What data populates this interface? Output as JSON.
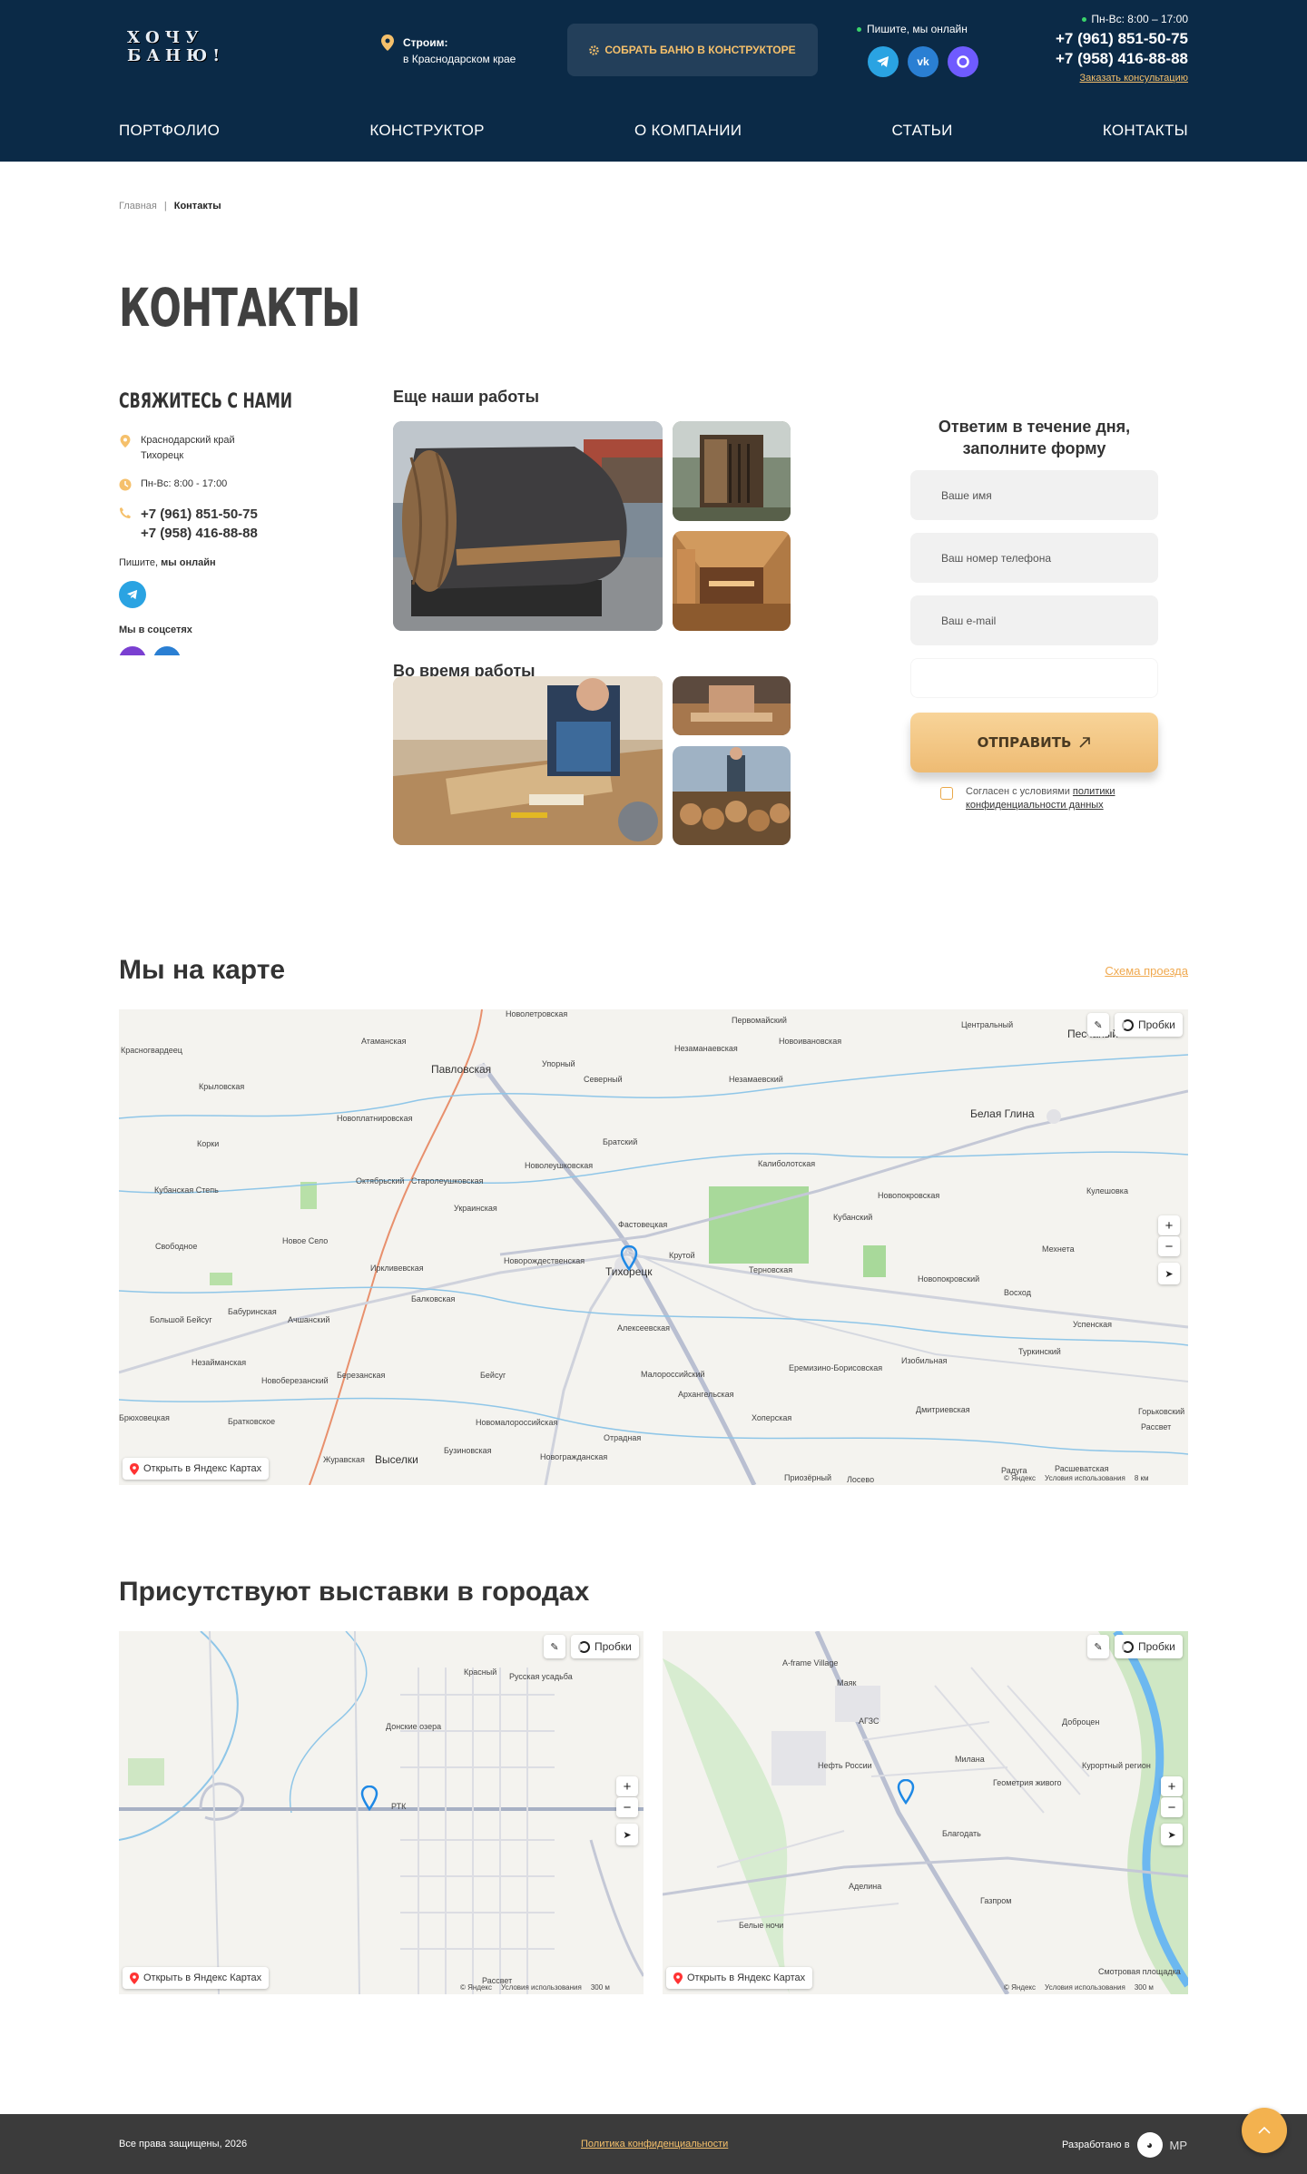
{
  "header": {
    "logo_line1": "ХОЧУ",
    "logo_line2": "БАНЮ!",
    "build_title": "Строим:",
    "build_region": "в Краснодарском крае",
    "constructor_button": "СОБРАТЬ БАНЮ В КОНСТРУКТОРЕ",
    "online_label": "Пишите, мы онлайн",
    "hours": "Пн-Вс: 8:00 – 17:00",
    "phone1": "+7 (961) 851-50-75",
    "phone2": "+7 (958) 416-88-88",
    "consult_link": "Заказать консультацию",
    "nav": [
      "ПОРТФОЛИО",
      "КОНСТРУКТОР",
      "О КОМПАНИИ",
      "СТАТЬИ",
      "КОНТАКТЫ"
    ]
  },
  "breadcrumb": {
    "home": "Главная",
    "separator": "|",
    "current": "Контакты"
  },
  "page_title": "КОНТАКТЫ",
  "contact": {
    "heading": "СВЯЖИТЕСЬ С НАМИ",
    "address_line1": "Краснодарский край",
    "address_line2": "Тихорецк",
    "hours": "Пн-Вс: 8:00 - 17:00",
    "phone1": "+7 (961) 851-50-75",
    "phone2": "+7 (958) 416-88-88",
    "write_prefix": "Пишите, ",
    "write_bold": "мы онлайн",
    "socials_label": "Мы в соцсетях"
  },
  "works": {
    "more_title": "Еще наши работы",
    "during_title": "Во время работы"
  },
  "form": {
    "title": "Ответим в течение дня, заполните форму",
    "name_placeholder": "Ваше имя",
    "phone_placeholder": "Ваш номер телефона",
    "email_placeholder": "Ваш e-mail",
    "submit": "ОТПРАВИТЬ",
    "agree_text": "Согласен с условиями ",
    "agree_link": "политики конфиденциальности данных"
  },
  "map_section": {
    "title": "Мы на карте",
    "route_link": "Схема проезда",
    "labels": [
      "Новолетровская",
      "Первомайский",
      "Центральный",
      "Песчаный",
      "Красногвардеец",
      "Атаманская",
      "Павловская",
      "Упорный",
      "Незаманаевская",
      "Новоивановская",
      "Крыловская",
      "Северный",
      "Незамаевский",
      "Новоплатнировская",
      "Братский",
      "Белая Глина",
      "Корки",
      "Новолеушковская",
      "Калиболотская",
      "Кубанская Степь",
      "Октябрьский",
      "Старолеушковская",
      "Новопокровская",
      "Кулешовка",
      "Украинская",
      "Фастовецкая",
      "Кубанский",
      "Свободное",
      "Новое Село",
      "Новорождественская",
      "Тихорецк",
      "Крутой",
      "Терновская",
      "Мехнета",
      "Иркливевская",
      "Новопокровский",
      "Восход",
      "Балковская",
      "Бабуринская",
      "Алексеевская",
      "Большой Бейсуг",
      "Ачшанский",
      "Успенская",
      "Незайманская",
      "Березанская",
      "Бейсуг",
      "Малороссийский",
      "Еремизино-Борисовская",
      "Изобильная",
      "Туркинский",
      "Новоберезанский",
      "Архангельская",
      "Дмитриевская",
      "Горьковский",
      "Брюховецкая",
      "Братковское",
      "Новомалороссийская",
      "Хоперская",
      "Рассвет",
      "Отрадная",
      "Журавская",
      "Выселки",
      "Бузиновская",
      "Новогражданская",
      "Приозёрный",
      "Лосево",
      "Радуга",
      "Расшеватская"
    ],
    "traffic": "Пробки",
    "open_in_yandex": "Открыть в Яндекс Картах",
    "copyright": "© Яндекс",
    "terms": "Условия использования",
    "scale": "8 км"
  },
  "exhibitions": {
    "title": "Присутствуют выставки в городах",
    "map1": {
      "labels": [
        "Красный",
        "Русская усадьба",
        "Донские озера",
        "РТК",
        "Рассвет"
      ],
      "scale": "300 м"
    },
    "map2": {
      "labels": [
        "A-frame Village",
        "Маяк",
        "АГЗС",
        "Доброцен",
        "Нефть России",
        "Милана",
        "Геометрия живого",
        "Курортный регион",
        "Благодать",
        "Аделина",
        "Газпром",
        "Белые ночи",
        "Смотровая площадка"
      ],
      "scale": "300 м"
    }
  },
  "footer": {
    "copyright": "Все права защищены, 2026",
    "policy": "Политика конфиденциальности",
    "developed": "Разработано в",
    "dev_brand": "MP"
  },
  "colors": {
    "header_bg": "#0b2a47",
    "accent": "#f5c06b",
    "footer_bg": "#3b3b3b"
  }
}
